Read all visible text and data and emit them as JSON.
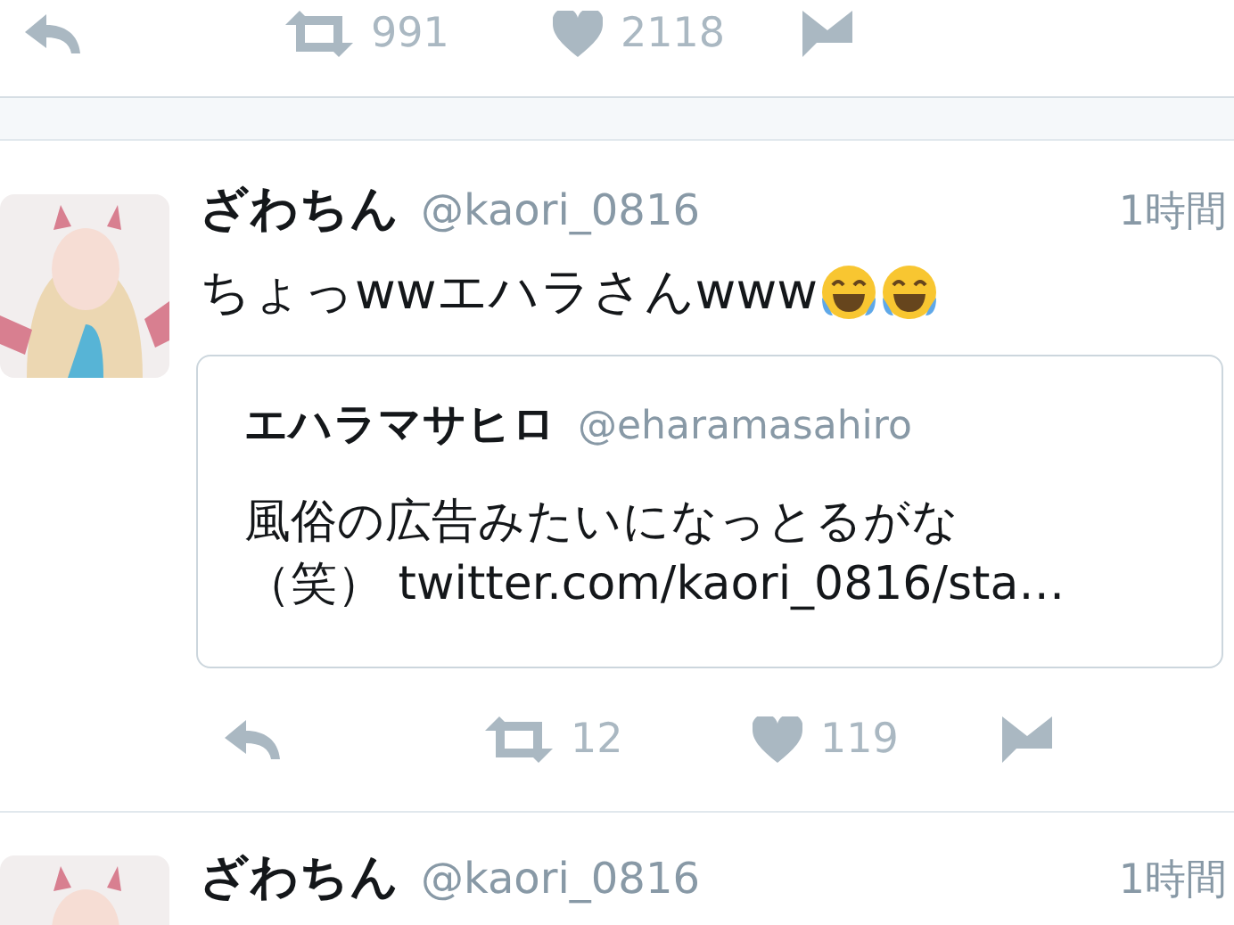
{
  "tweets": [
    {
      "kind": "partial",
      "retweets": "991",
      "likes": "2118"
    },
    {
      "kind": "full",
      "name": "ざわちん",
      "handle": "@kaori_0816",
      "time": "1時間",
      "text": "ちょっwwエハラさんwww",
      "emojis": [
        {
          "kind": "tears-of-joy"
        },
        {
          "kind": "tears-of-joy"
        }
      ],
      "quote": {
        "name": "エハラマサヒロ",
        "handle": "@eharamasahiro",
        "text": "風俗の広告みたいになっとるがな（笑） twitter.com/kaori_0816/sta…"
      },
      "retweets": "12",
      "likes": "119"
    },
    {
      "kind": "header",
      "name": "ざわちん",
      "handle": "@kaori_0816",
      "time": "1時間"
    }
  ]
}
